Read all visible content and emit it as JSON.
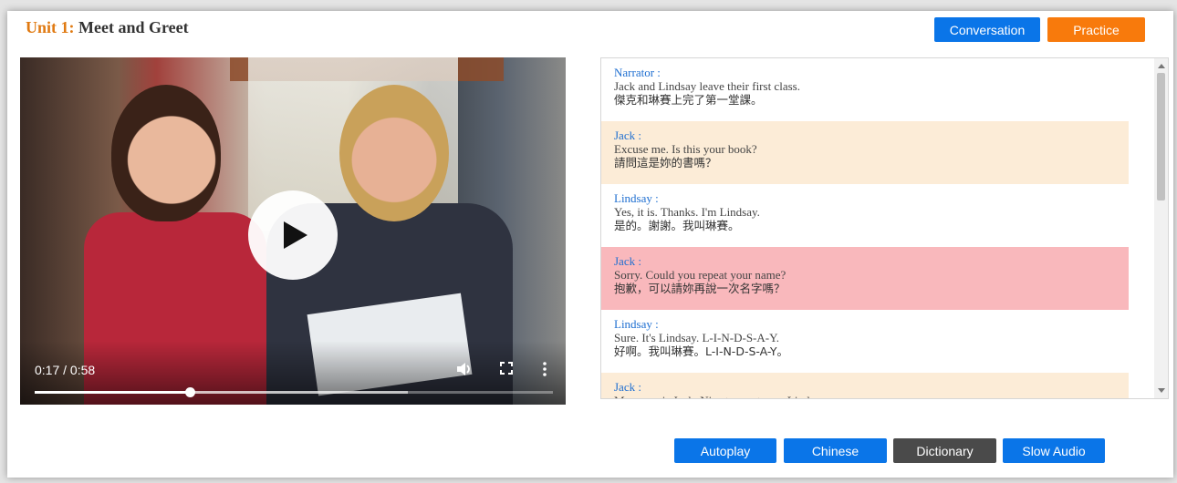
{
  "header": {
    "unit_label": "Unit 1:",
    "title": "Meet and Greet",
    "conversation_button": "Conversation",
    "practice_button": "Practice"
  },
  "video": {
    "time_display": "0:17 / 0:58",
    "progress_fraction": 0.3,
    "buffered_fraction": 0.72,
    "play_icon": "play-icon",
    "volume_icon": "volume-icon",
    "fullscreen_icon": "fullscreen-icon",
    "more_icon": "more-vert-icon"
  },
  "transcript": {
    "lines": [
      {
        "speaker": "Narrator :",
        "en": "Jack and Lindsay leave their first class.",
        "zh": "傑克和琳賽上完了第一堂課。",
        "style": "plain"
      },
      {
        "speaker": "Jack :",
        "en": "Excuse me. Is this your book?",
        "zh": "請問這是妳的書嗎？",
        "style": "alt"
      },
      {
        "speaker": "Lindsay :",
        "en": "Yes, it is. Thanks. I'm Lindsay.",
        "zh": "是的。謝謝。我叫琳賽。",
        "style": "plain"
      },
      {
        "speaker": "Jack :",
        "en": "Sorry. Could you repeat your name?",
        "zh": "抱歉，可以請妳再說一次名字嗎？",
        "style": "active"
      },
      {
        "speaker": "Lindsay :",
        "en": "Sure. It's Lindsay. L-I-N-D-S-A-Y.",
        "zh": "好啊。我叫琳賽。L-I-N-D-S-A-Y。",
        "style": "plain"
      },
      {
        "speaker": "Jack :",
        "en": "My name is Jack. Nice to meet you, Lindsay.",
        "zh": "",
        "style": "alt"
      }
    ]
  },
  "toolbar": {
    "autoplay": "Autoplay",
    "chinese": "Chinese",
    "dictionary": "Dictionary",
    "slow_audio": "Slow Audio"
  },
  "colors": {
    "accent_blue": "#0a75e8",
    "accent_orange": "#f87a0c",
    "highlight_active": "#f9b8bc",
    "highlight_alt": "#fcecd7"
  }
}
